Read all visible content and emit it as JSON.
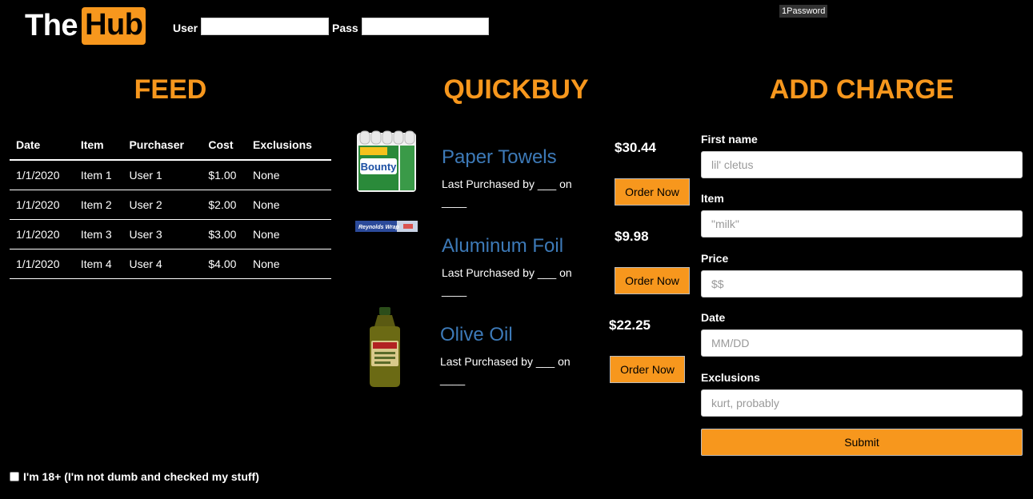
{
  "header": {
    "logo_the": "The",
    "logo_hub": "Hub",
    "user_label": "User",
    "pass_label": "Pass",
    "password_manager_badge": "1Password"
  },
  "feed": {
    "title": "FEED",
    "columns": [
      "Date",
      "Item",
      "Purchaser",
      "Cost",
      "Exclusions"
    ],
    "rows": [
      [
        "1/1/2020",
        "Item 1",
        "User 1",
        "$1.00",
        "None"
      ],
      [
        "1/1/2020",
        "Item 2",
        "User 2",
        "$2.00",
        "None"
      ],
      [
        "1/1/2020",
        "Item 3",
        "User 3",
        "$3.00",
        "None"
      ],
      [
        "1/1/2020",
        "Item 4",
        "User 4",
        "$4.00",
        "None"
      ]
    ]
  },
  "quickbuy": {
    "title": "QUICKBUY",
    "items": [
      {
        "name": "Paper Towels",
        "price": "$30.44",
        "last_purchased": "Last Purchased by ___ on ____",
        "button": "Order Now",
        "image": "paper-towels-image"
      },
      {
        "name": "Aluminum Foil",
        "price": "$9.98",
        "last_purchased": "Last Purchased by ___ on ____",
        "button": "Order Now",
        "image": "aluminum-foil-image"
      },
      {
        "name": "Olive Oil",
        "price": "$22.25",
        "last_purchased": "Last Purchased by ___ on ____",
        "button": "Order Now",
        "image": "olive-oil-image"
      }
    ]
  },
  "add_charge": {
    "title": "ADD CHARGE",
    "first_name_label": "First name",
    "first_name_placeholder": "lil' cletus",
    "item_label": "Item",
    "item_placeholder": "\"milk\"",
    "price_label": "Price",
    "price_placeholder": "$$",
    "date_label": "Date",
    "date_placeholder": "MM/DD",
    "exclusions_label": "Exclusions",
    "exclusions_placeholder": "kurt, probably",
    "submit_label": "Submit"
  },
  "footer": {
    "age_checkbox_label": "I'm 18+ (I'm not dumb and checked my stuff)",
    "age_checked": false
  },
  "colors": {
    "accent": "#f7971d",
    "link_blue": "#3d7ab8",
    "background": "#000000"
  }
}
